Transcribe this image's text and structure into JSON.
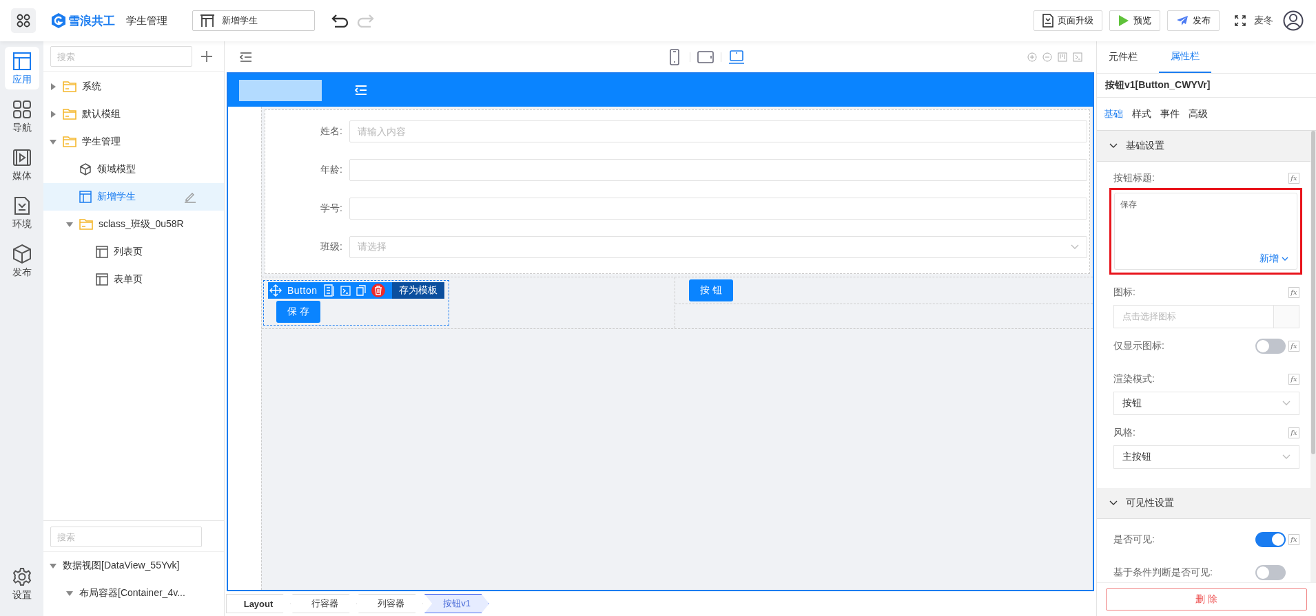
{
  "topbar": {
    "logo": "雪浪共工",
    "app_name": "学生管理",
    "page_select": "新增学生",
    "actions": [
      {
        "label": "页面升级",
        "kind": "upgrade"
      },
      {
        "label": "预览",
        "kind": "preview"
      },
      {
        "label": "发布",
        "kind": "publish"
      }
    ],
    "user": "麦冬"
  },
  "rail": {
    "items": [
      {
        "label": "应用",
        "kind": "app",
        "selected": true
      },
      {
        "label": "导航",
        "kind": "nav",
        "selected": false
      },
      {
        "label": "媒体",
        "kind": "media",
        "selected": false
      },
      {
        "label": "环境",
        "kind": "env",
        "selected": false
      },
      {
        "label": "发布",
        "kind": "publish",
        "selected": false
      }
    ],
    "settings": "设置"
  },
  "tree": {
    "search_placeholder": "搜索",
    "items": [
      {
        "label": "系统",
        "kind": "folder",
        "expanded": false,
        "selected": false
      },
      {
        "label": "默认模组",
        "kind": "folder",
        "expanded": false,
        "selected": false
      },
      {
        "label": "学生管理",
        "kind": "folder",
        "expanded": true,
        "selected": false,
        "children": [
          {
            "label": "领域模型",
            "kind": "model",
            "selected": false
          },
          {
            "label": "新增学生",
            "kind": "page",
            "selected": true
          },
          {
            "label": "sclass_班级_0u58R",
            "kind": "folder",
            "expanded": true,
            "selected": false,
            "children": [
              {
                "label": "列表页",
                "kind": "page",
                "selected": false
              },
              {
                "label": "表单页",
                "kind": "page",
                "selected": false
              }
            ]
          }
        ]
      }
    ]
  },
  "outline": {
    "search_placeholder": "搜索",
    "items": [
      {
        "label": "数据视图[DataView_55Yvk]",
        "expanded": true,
        "children": [
          {
            "label": "布局容器[Container_4v...",
            "expanded": true
          }
        ]
      }
    ]
  },
  "canvas": {
    "devices": [
      {
        "kind": "phone",
        "selected": false
      },
      {
        "kind": "tablet",
        "selected": false
      },
      {
        "kind": "desktop",
        "selected": true
      }
    ],
    "form": [
      {
        "label": "姓名:",
        "kind": "input",
        "placeholder": "请输入内容"
      },
      {
        "label": "年龄:",
        "kind": "input"
      },
      {
        "label": "学号:",
        "kind": "input"
      },
      {
        "label": "班级:",
        "kind": "select",
        "placeholder": "请选择"
      }
    ],
    "selection": {
      "name": "Button",
      "save_template": "存为模板"
    },
    "buttons": [
      {
        "label": "保 存",
        "selected": true
      },
      {
        "label": "按 钮",
        "selected": false
      }
    ]
  },
  "breadcrumb": [
    {
      "label": "Layout",
      "selected": false
    },
    {
      "label": "行容器",
      "selected": false
    },
    {
      "label": "列容器",
      "selected": false
    },
    {
      "label": "按钮v1",
      "selected": true
    }
  ],
  "props": {
    "tabs": [
      {
        "label": "元件栏",
        "selected": false
      },
      {
        "label": "属性栏",
        "selected": true
      }
    ],
    "component_title": "按钮v1[Button_CWYVr]",
    "subtabs": [
      {
        "label": "基础",
        "selected": true
      },
      {
        "label": "样式",
        "selected": false
      },
      {
        "label": "事件",
        "selected": false
      },
      {
        "label": "高级",
        "selected": false
      }
    ],
    "sections": [
      {
        "title": "基础设置",
        "expanded": true,
        "fields": [
          {
            "kind": "textarea",
            "label": "按钮标题:",
            "fx": "fx",
            "value": "保存",
            "action": "新增",
            "highlighted": true
          },
          {
            "kind": "icon-picker",
            "label": "图标:",
            "fx": "fx",
            "placeholder": "点击选择图标"
          },
          {
            "kind": "switch",
            "label": "仅显示图标:",
            "fx": "fx",
            "on": false
          },
          {
            "kind": "select",
            "label": "渲染模式:",
            "fx": "fx",
            "value": "按钮"
          },
          {
            "kind": "select",
            "label": "风格:",
            "fx": "fx",
            "value": "主按钮"
          }
        ]
      },
      {
        "title": "可见性设置",
        "expanded": true,
        "fields": [
          {
            "kind": "switch",
            "label": "是否可见:",
            "fx": "fx",
            "on": true
          },
          {
            "kind": "switch",
            "label": "基于条件判断是否可见:",
            "on": false
          }
        ]
      }
    ],
    "delete": "删 除"
  }
}
